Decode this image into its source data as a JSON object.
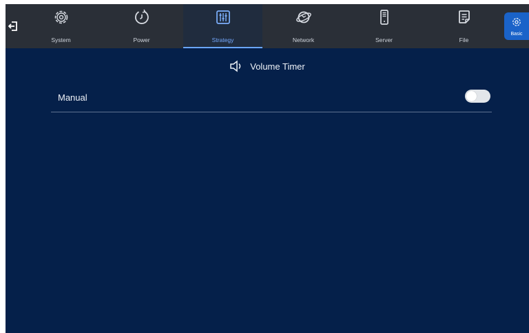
{
  "nav": {
    "back_icon": "exit-arrow-icon",
    "tabs": [
      {
        "label": "System",
        "icon": "gear-icon",
        "active": false
      },
      {
        "label": "Power",
        "icon": "power-clock-icon",
        "active": false
      },
      {
        "label": "Strategy",
        "icon": "sliders-icon",
        "active": true
      },
      {
        "label": "Network",
        "icon": "globe-icon",
        "active": false
      },
      {
        "label": "Server",
        "icon": "server-icon",
        "active": false
      },
      {
        "label": "File",
        "icon": "file-icon",
        "active": false
      }
    ],
    "basic": {
      "label": "Basic",
      "icon": "gear-icon"
    }
  },
  "section": {
    "title": "Volume Timer",
    "icon": "speaker-icon"
  },
  "settings": {
    "manual": {
      "label": "Manual",
      "on": false
    }
  },
  "colors": {
    "background": "#05204a",
    "topbar": "#2a2f37",
    "accent": "#6aa6ff",
    "basic_button": "#1a63c9"
  }
}
